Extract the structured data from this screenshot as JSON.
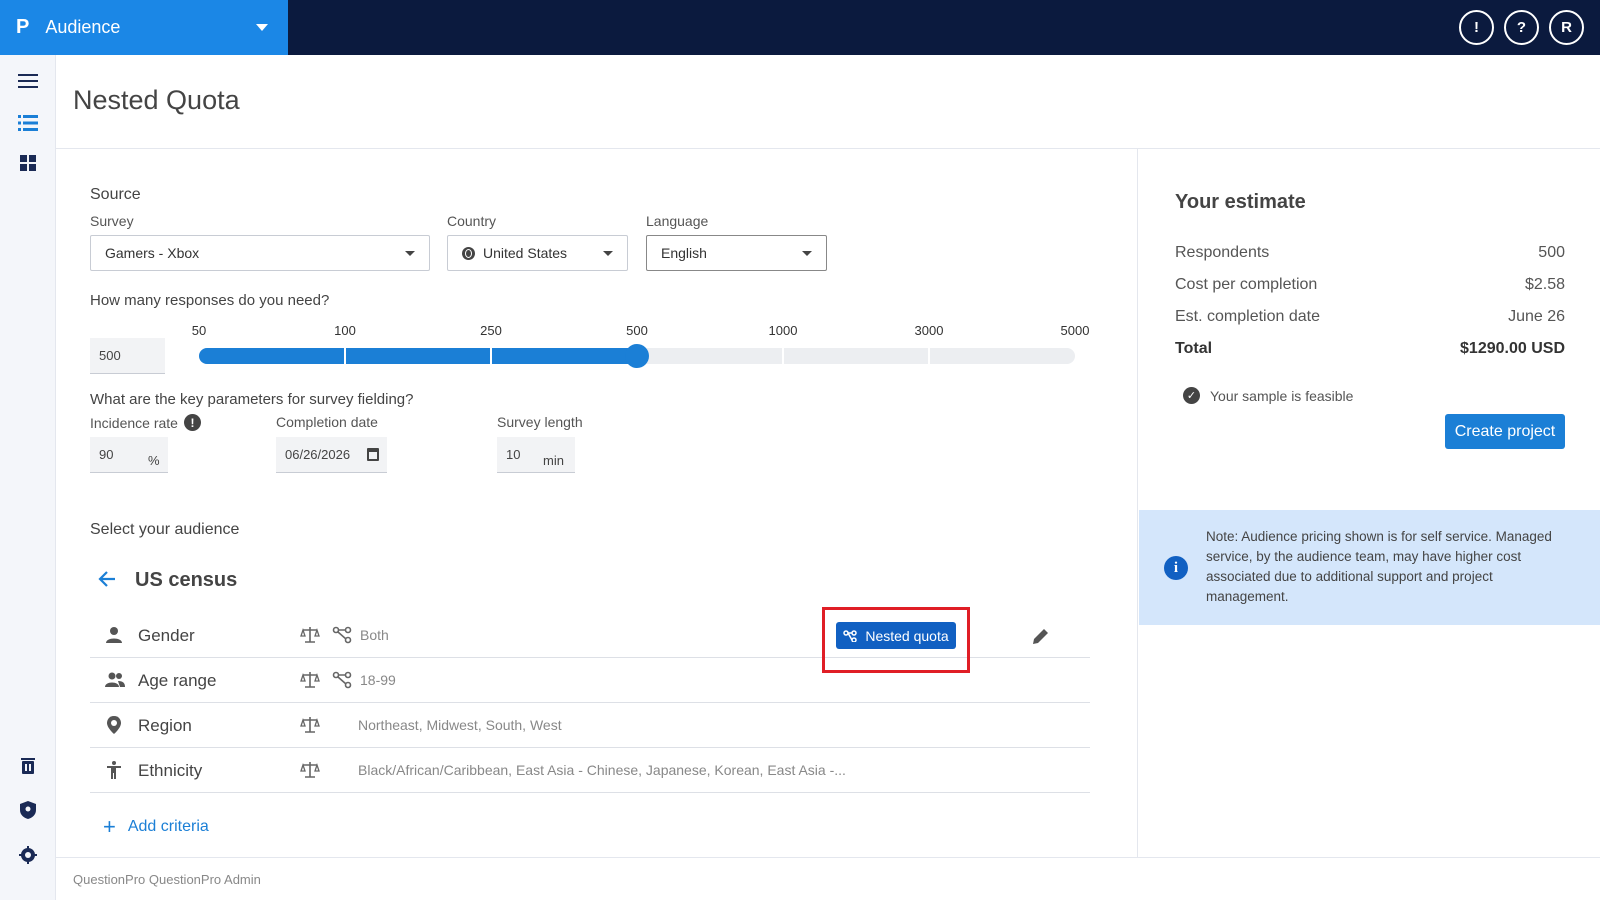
{
  "header": {
    "brand_logo": "P",
    "brand_title": "Audience",
    "actions": {
      "feedback_icon": "!",
      "help_icon": "?",
      "avatar": "R"
    }
  },
  "rail": {
    "icons": [
      "menu-icon",
      "list-icon",
      "dashboard-icon",
      "trash-icon",
      "shield-icon",
      "settings-icon"
    ]
  },
  "page": {
    "title": "Nested Quota"
  },
  "form": {
    "source_heading": "Source",
    "survey_label": "Survey",
    "survey_value": "Gamers - Xbox",
    "country_label": "Country",
    "country_value": "United States",
    "language_label": "Language",
    "language_value": "English",
    "responses_question": "How many responses do you need?",
    "responses_value": "500",
    "slider": {
      "ticks": [
        "50",
        "100",
        "250",
        "500",
        "1000",
        "3000",
        "5000"
      ],
      "selected_index": 3
    },
    "params_question": "What are the key parameters for survey fielding?",
    "incidence_label": "Incidence rate",
    "incidence_value": "90",
    "incidence_unit": "%",
    "completion_label": "Completion date",
    "completion_value": "06/26/2026",
    "length_label": "Survey length",
    "length_value": "10",
    "length_unit": "min"
  },
  "audience": {
    "heading": "Select your audience",
    "title": "US census",
    "criteria": [
      {
        "name": "Gender",
        "icon": "person-icon",
        "nested": true,
        "value": "Both"
      },
      {
        "name": "Age range",
        "icon": "people-icon",
        "nested": true,
        "value": "18-99"
      },
      {
        "name": "Region",
        "icon": "location-icon",
        "nested": false,
        "value": "Northeast, Midwest, South, West"
      },
      {
        "name": "Ethnicity",
        "icon": "accessibility-icon",
        "nested": false,
        "value": "Black/African/Caribbean, East Asia - Chinese, Japanese, Korean, East Asia -..."
      }
    ],
    "nested_quota_label": "Nested quota",
    "add_criteria_label": "Add criteria"
  },
  "estimate": {
    "title": "Your estimate",
    "rows": [
      {
        "label": "Respondents",
        "value": "500"
      },
      {
        "label": "Cost per completion",
        "value": "$2.58"
      },
      {
        "label": "Est. completion date",
        "value": "June 26"
      },
      {
        "label": "Total",
        "value": "$1290.00 USD"
      }
    ],
    "feasible_text": "Your sample is feasible",
    "create_label": "Create project",
    "note": "Note: Audience pricing shown is for self service. Managed service, by the audience team, may have higher cost associated due to additional support and project management."
  },
  "footer": {
    "text": "QuestionPro QuestionPro Admin"
  },
  "colors": {
    "brand": "#1b87e6",
    "topbar": "#0b1a3e",
    "accent": "#1b7fd6",
    "highlight": "#e01e26",
    "note_bg": "#d4e6fb"
  }
}
